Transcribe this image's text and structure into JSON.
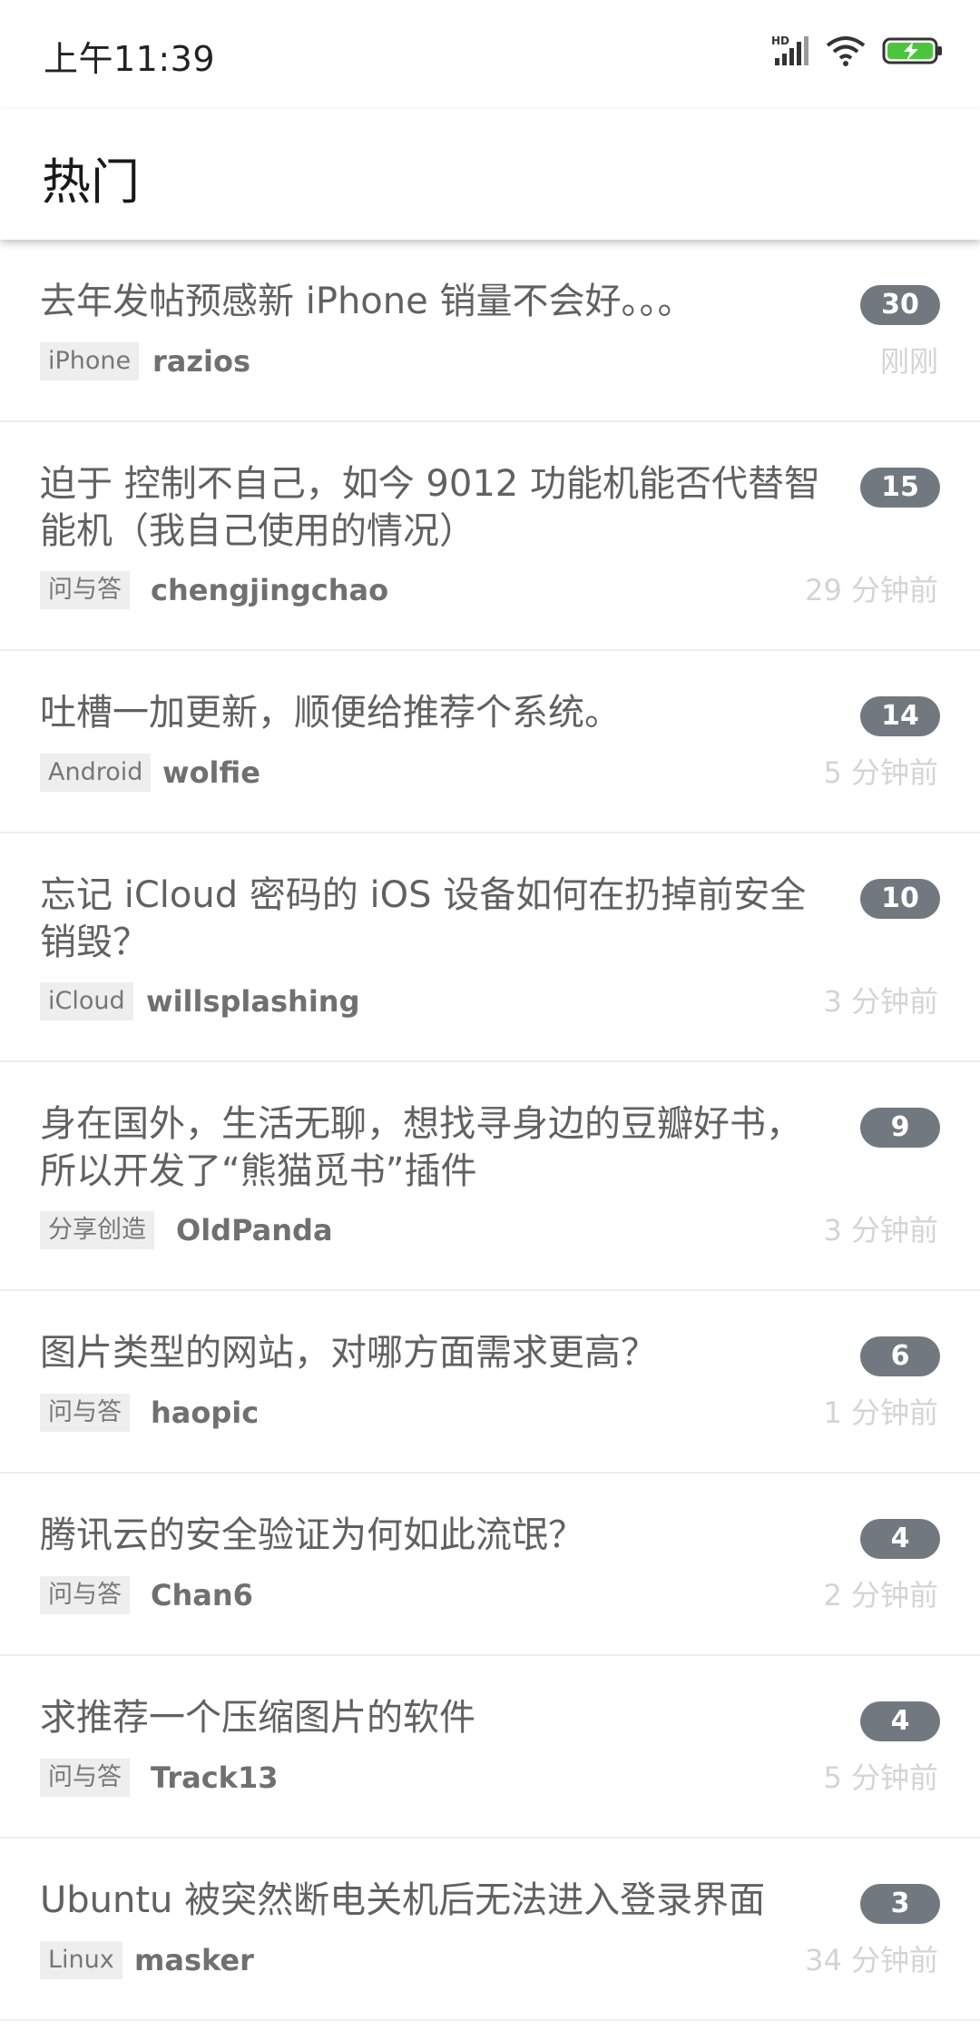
{
  "status_bar": {
    "time": "上午11:39",
    "icons": [
      "hd-signal-icon",
      "wifi-icon",
      "battery-charging-icon"
    ],
    "hd_text": "HD"
  },
  "app_bar": {
    "title": "热门"
  },
  "colors": {
    "badge": "#717880",
    "tag_bg": "#eeeeee",
    "title_text": "#616161",
    "time_text": "#d4d4d4",
    "battery": "#4cc43c"
  },
  "topics": [
    {
      "title": "去年发帖预感新 iPhone 销量不会好。。。",
      "count": "30",
      "node": "iPhone",
      "author": "razios",
      "time": "刚刚"
    },
    {
      "title": "迫于 控制不自己，如今 9012 功能机能否代替智能机（我自己使用的情况）",
      "count": "15",
      "node": "问与答",
      "author": "chengjingchao",
      "time": "29 分钟前"
    },
    {
      "title": "吐槽一加更新，顺便给推荐个系统。",
      "count": "14",
      "node": "Android",
      "author": "wolfie",
      "time": "5 分钟前"
    },
    {
      "title": "忘记 iCloud 密码的 iOS 设备如何在扔掉前安全销毁？",
      "count": "10",
      "node": "iCloud",
      "author": "willsplashing",
      "time": "3 分钟前"
    },
    {
      "title": "身在国外，生活无聊，想找寻身边的豆瓣好书，所以开发了“熊猫觅书”插件",
      "count": "9",
      "node": "分享创造",
      "author": "OldPanda",
      "time": "3 分钟前"
    },
    {
      "title": "图片类型的网站，对哪方面需求更高？",
      "count": "6",
      "node": "问与答",
      "author": "haopic",
      "time": "1 分钟前"
    },
    {
      "title": "腾讯云的安全验证为何如此流氓？",
      "count": "4",
      "node": "问与答",
      "author": "Chan6",
      "time": "2 分钟前"
    },
    {
      "title": "求推荐一个压缩图片的软件",
      "count": "4",
      "node": "问与答",
      "author": "Track13",
      "time": "5 分钟前"
    },
    {
      "title": "Ubuntu 被突然断电关机后无法进入登录界面",
      "count": "3",
      "node": "Linux",
      "author": "masker",
      "time": "34 分钟前"
    }
  ]
}
